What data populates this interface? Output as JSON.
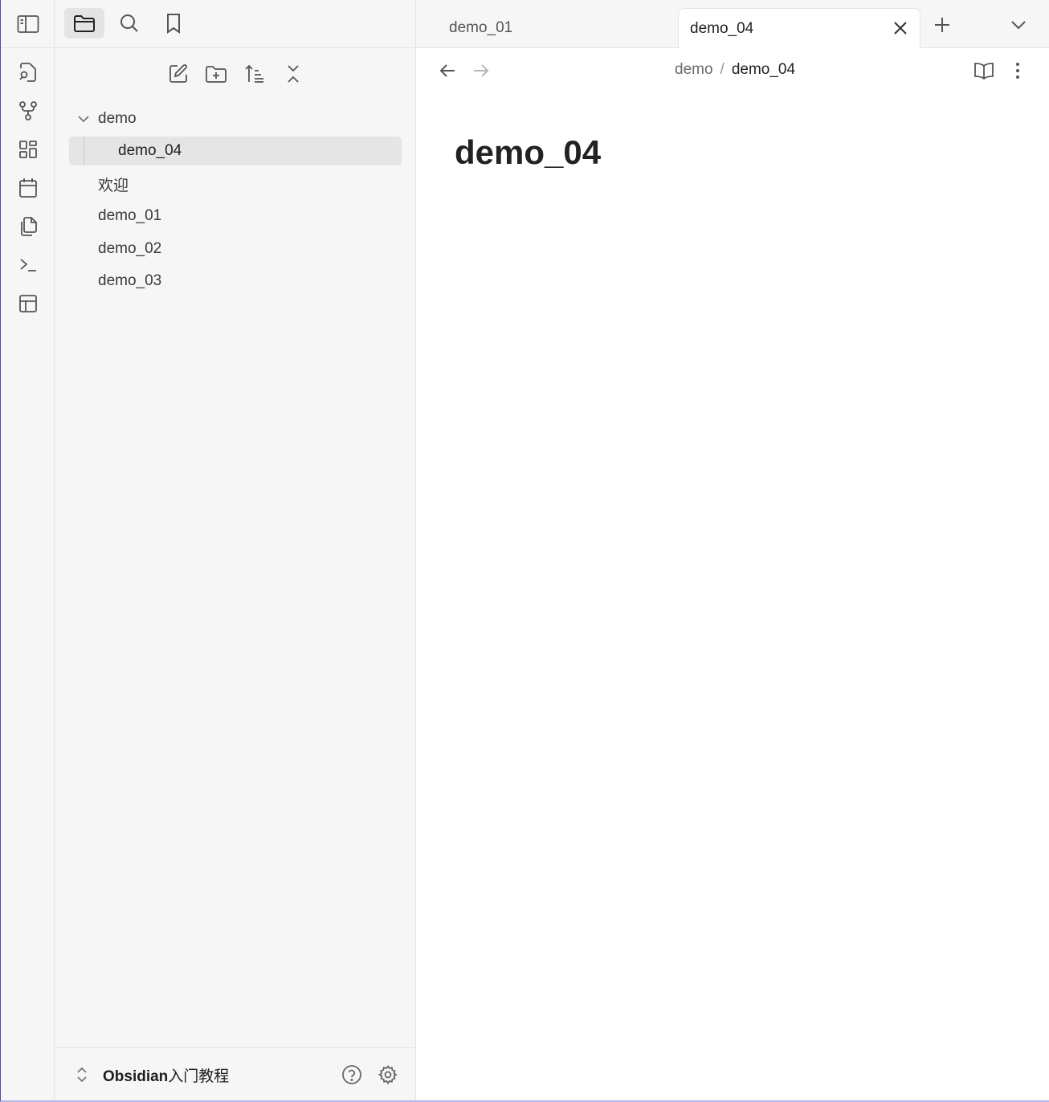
{
  "sidebar": {
    "tree": {
      "folder_label": "demo",
      "nested_file": "demo_04",
      "files": [
        "欢迎",
        "demo_01",
        "demo_02",
        "demo_03"
      ]
    },
    "vault": {
      "name_latin": "Obsidian",
      "name_cn": "入门教程"
    }
  },
  "tabs": {
    "inactive_label": "demo_01",
    "active_label": "demo_04"
  },
  "breadcrumb": {
    "parent": "demo",
    "separator": "/",
    "current": "demo_04"
  },
  "document": {
    "title": "demo_04"
  },
  "colors": {
    "sidebar_bg": "#f6f6f6",
    "selected_bg": "#e4e4e4",
    "frame_accent": "#5b3fa0"
  }
}
